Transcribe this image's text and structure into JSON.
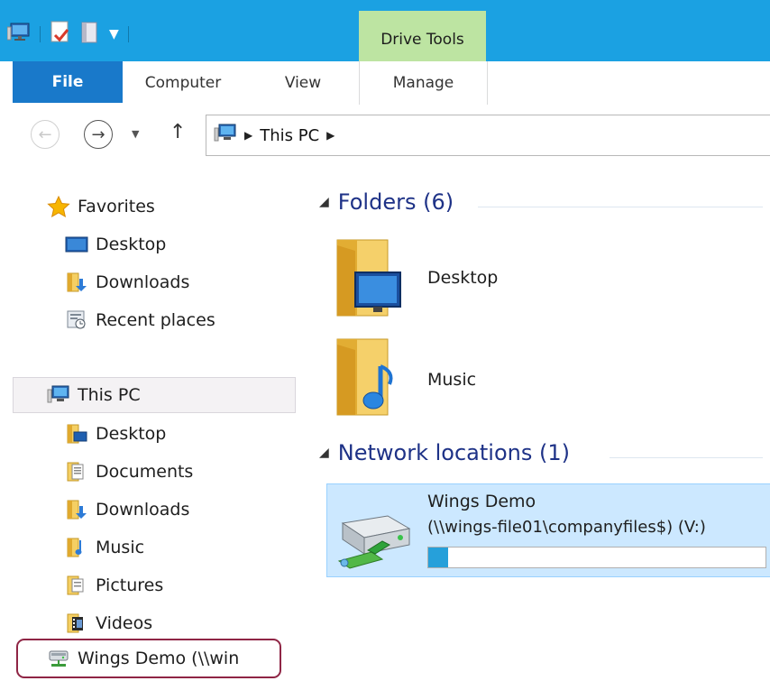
{
  "ribbon": {
    "context_group": "Drive Tools",
    "tabs": {
      "file": "File",
      "computer": "Computer",
      "view": "View",
      "manage": "Manage"
    }
  },
  "address": {
    "crumbs": [
      "This PC"
    ]
  },
  "nav": {
    "favorites": {
      "label": "Favorites",
      "items": [
        "Desktop",
        "Downloads",
        "Recent places"
      ]
    },
    "this_pc": {
      "label": "This PC",
      "items": [
        "Desktop",
        "Documents",
        "Downloads",
        "Music",
        "Pictures",
        "Videos"
      ]
    },
    "network_item": "Wings Demo (\\\\win­"
  },
  "content": {
    "folders_header": "Folders (6)",
    "folders": [
      "Desktop",
      "Music"
    ],
    "network_header": "Network locations (1)",
    "network": {
      "name": "Wings Demo",
      "path": "(\\\\wings-file01\\companyfiles$) (V:)",
      "usage_fraction": 0.06
    }
  },
  "colors": {
    "titlebar": "#1ba1e2",
    "file_tab": "#1979ca",
    "drive_tools": "#bde4a2",
    "selection": "#cce8ff",
    "header_text": "#1e3287"
  }
}
